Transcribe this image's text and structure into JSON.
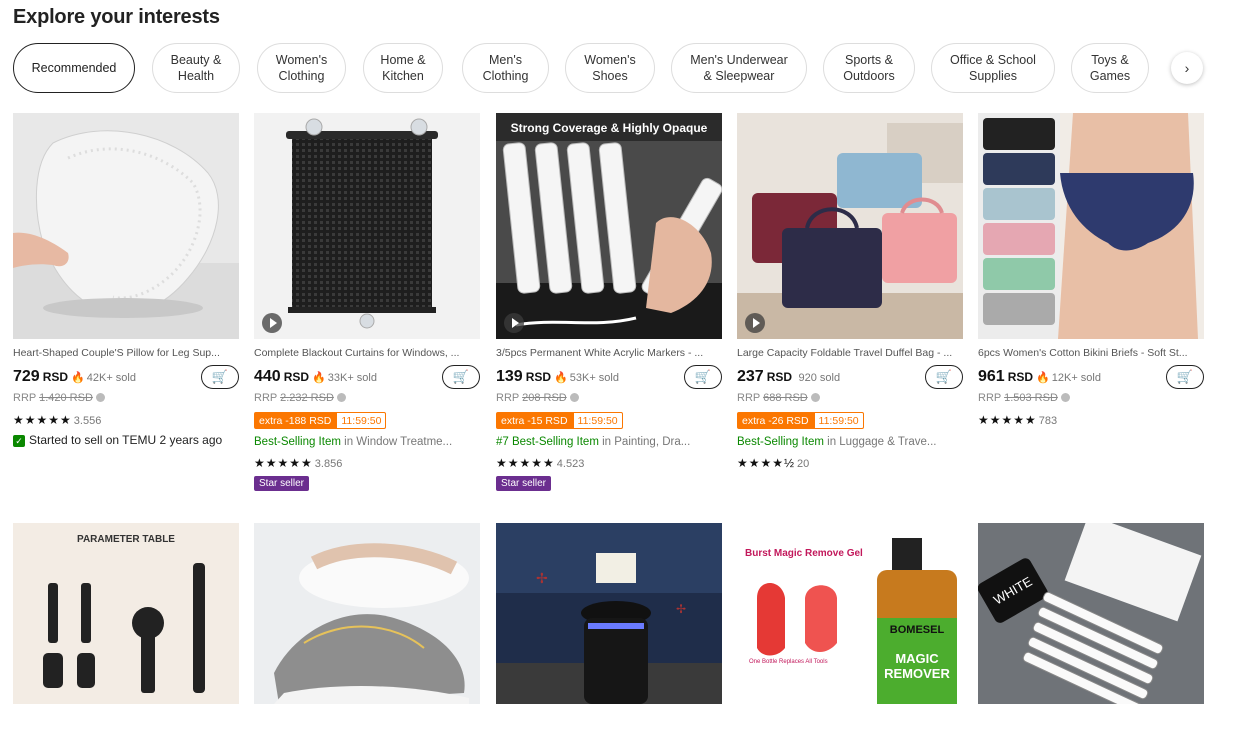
{
  "heading": "Explore your interests",
  "categories": [
    {
      "label": "Recommended"
    },
    {
      "label": "Beauty &\nHealth"
    },
    {
      "label": "Women's\nClothing"
    },
    {
      "label": "Home &\nKitchen"
    },
    {
      "label": "Men's\nClothing"
    },
    {
      "label": "Women's\nShoes"
    },
    {
      "label": "Men's Underwear\n& Sleepwear"
    },
    {
      "label": "Sports &\nOutdoors"
    },
    {
      "label": "Office & School\nSupplies"
    },
    {
      "label": "Toys &\nGames"
    }
  ],
  "next_icon": "›",
  "products": [
    {
      "title": "Heart-Shaped Couple'S Pillow for Leg Sup...",
      "price": "729",
      "currency": "RSD",
      "sold": "42K+ sold",
      "rrp_label": "RRP",
      "rrp": "1.420 RSD",
      "rating_count": "3.556",
      "started": "Started to sell on TEMU 2 years ago"
    },
    {
      "title": "Complete Blackout Curtains for Windows, ...",
      "price": "440",
      "currency": "RSD",
      "sold": "33K+ sold",
      "rrp_label": "RRP",
      "rrp": "2.232 RSD",
      "extra": "extra -188 RSD",
      "timer": "11:59:50",
      "best": "Best-Selling Item",
      "best_in": " in Window Treatme...",
      "rating_count": "3.856",
      "badge": "Star seller"
    },
    {
      "title": "3/5pcs Permanent White Acrylic Markers - ...",
      "price": "139",
      "currency": "RSD",
      "sold": "53K+ sold",
      "rrp_label": "RRP",
      "rrp": "208 RSD",
      "extra": "extra -15 RSD",
      "timer": "11:59:50",
      "best": "#7 Best-Selling Item",
      "best_in": " in Painting, Dra...",
      "rating_count": "4.523",
      "badge": "Star seller"
    },
    {
      "title": "Large Capacity Foldable Travel Duffel Bag - ...",
      "price": "237",
      "currency": "RSD",
      "sold": "920 sold",
      "rrp_label": "RRP",
      "rrp": "688 RSD",
      "extra": "extra -26 RSD",
      "timer": "11:59:50",
      "best": "Best-Selling Item",
      "best_in": " in Luggage & Trave...",
      "rating_count": "20"
    },
    {
      "title": "6pcs Women's Cotton Bikini Briefs - Soft St...",
      "price": "961",
      "currency": "RSD",
      "sold": "12K+ sold",
      "rrp_label": "RRP",
      "rrp": "1.503 RSD",
      "rating_count": "783"
    }
  ],
  "image_texts": {
    "marker_banner": "Strong Coverage & Highly Opaque",
    "parameter_table": "PARAMETER TABLE",
    "burst_magic": "Burst Magic Remove Gel",
    "one_bottle": "One Bottle Replaces All Tools",
    "bomesel": "BOMESEL",
    "magic": "MAGIC",
    "remover": "REMOVER",
    "white": "WHITE"
  },
  "colors": {
    "accent": "#fb7701",
    "green": "#0a8800",
    "star_seller": "#6b2e8f"
  }
}
